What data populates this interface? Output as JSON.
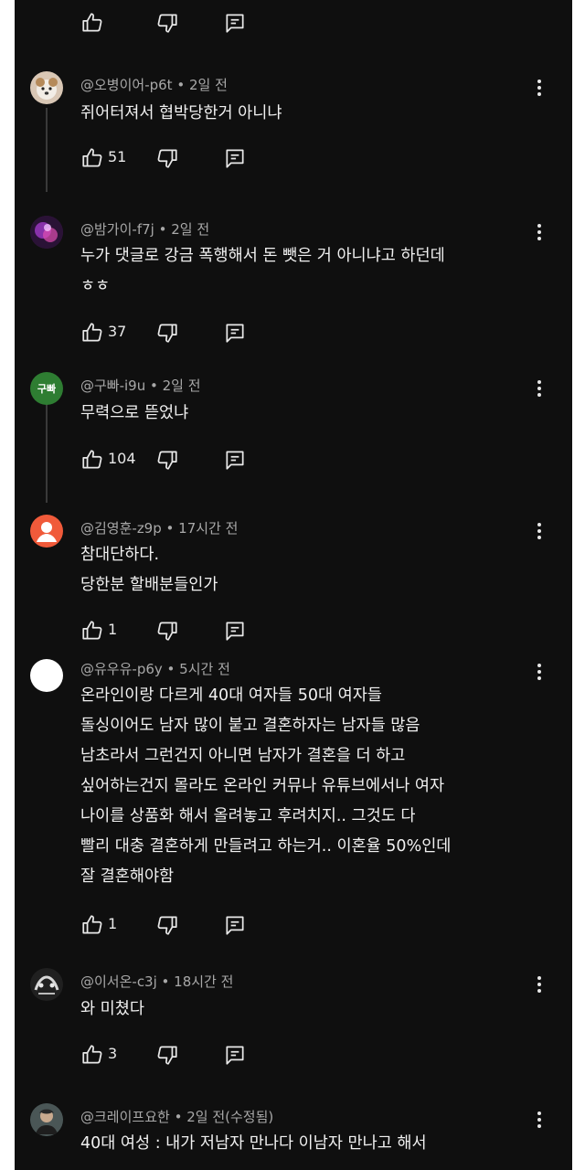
{
  "comments": [
    {
      "author": "@오병이어-p6t",
      "time": "2일 전",
      "lines": [
        "쥐어터져서 협박당한거 아니냐"
      ],
      "likes": "51"
    },
    {
      "author": "@밤가이-f7j",
      "time": "2일 전",
      "lines": [
        "누가 댓글로 강금 폭행해서 돈 뺏은 거 아니냐고 하던데",
        "ㅎㅎ"
      ],
      "likes": "37"
    },
    {
      "author": "@구빠-i9u",
      "time": "2일 전",
      "lines": [
        "무력으로 뜯었냐"
      ],
      "likes": "104",
      "avatar_text": "구빠"
    },
    {
      "author": "@김영훈-z9p",
      "time": "17시간 전",
      "lines": [
        "참대단하다.",
        "당한분 할배분들인가"
      ],
      "likes": "1"
    },
    {
      "author": "@유우유-p6y",
      "time": "5시간 전",
      "lines": [
        "온라인이랑 다르게 40대 여자들 50대 여자들",
        "돌싱이어도 남자 많이 붙고 결혼하자는 남자들 많음",
        "남초라서 그런건지 아니면 남자가 결혼을 더 하고",
        "싶어하는건지 몰라도 온라인 커뮤나 유튜브에서나 여자",
        "나이를 상품화 해서 올려놓고 후려치지.. 그것도 다",
        "빨리 대충 결혼하게 만들려고 하는거.. 이혼율 50%인데",
        "잘 결혼해야함"
      ],
      "likes": "1"
    },
    {
      "author": "@이서온-c3j",
      "time": "18시간 전",
      "lines": [
        "와 미쳤다"
      ],
      "likes": "3"
    },
    {
      "author": "@크레이프요한",
      "time": "2일 전(수정됨)",
      "lines": [
        "40대 여성 : 내가 저남자 만나다 이남자 만나고 해서"
      ],
      "likes": ""
    }
  ],
  "separator": " • ",
  "icons": {
    "like": "thumb-up-icon",
    "dislike": "thumb-down-icon",
    "reply": "reply-icon",
    "more": "more-vert-icon"
  },
  "colors": {
    "background": "#0f0f0f",
    "text": "#f1f1f1",
    "meta": "#a8a8a8"
  }
}
